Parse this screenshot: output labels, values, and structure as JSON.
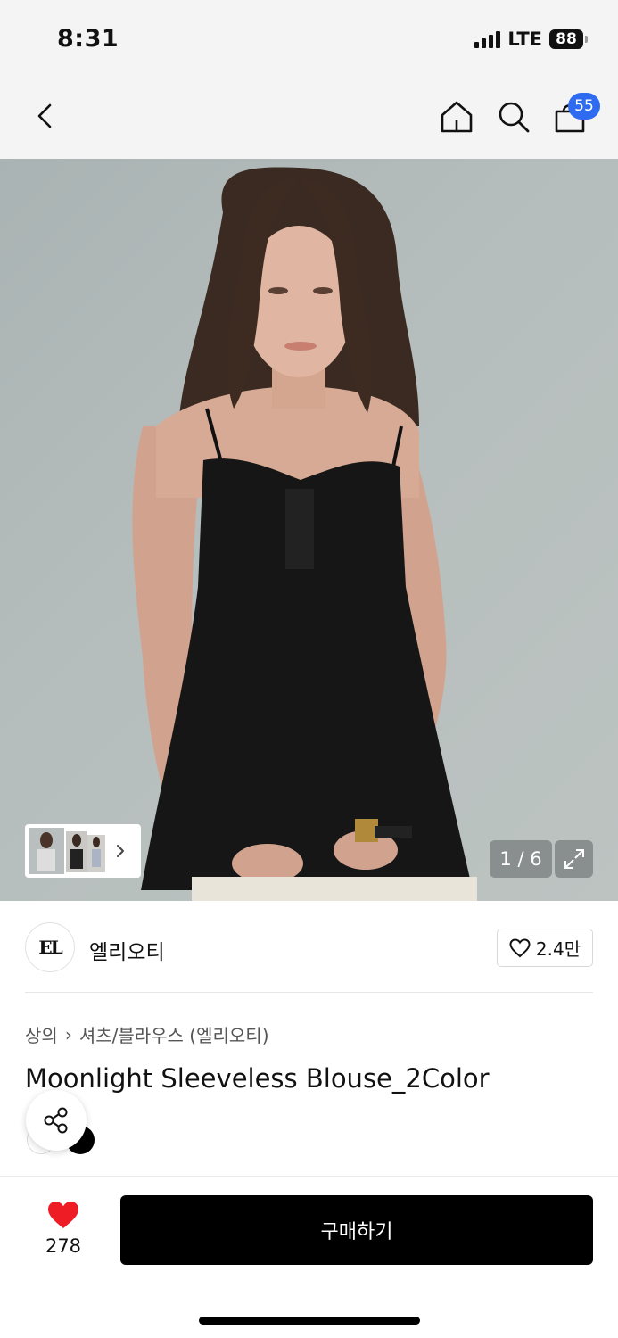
{
  "status_bar": {
    "time": "8:31",
    "network": "LTE",
    "battery": "88"
  },
  "nav": {
    "back_icon": "chevron-left-icon",
    "home_icon": "home-icon",
    "search_icon": "search-icon",
    "cart_icon": "shopping-bag-icon",
    "cart_count": "55",
    "badge_color": "#2f6bf0"
  },
  "gallery": {
    "counter": "1 / 6",
    "expand_icon": "expand-icon",
    "thumbnail_arrow_icon": "chevron-right-icon"
  },
  "brand": {
    "logo_text": "EL",
    "name": "엘리오티",
    "like_count": "2.4만"
  },
  "product": {
    "breadcrumb": [
      "상의",
      "셔츠/블라우스 (엘리오티)"
    ],
    "title": "Moonlight Sleeveless Blouse_2Color",
    "colors": [
      "#ffffff",
      "#000000"
    ]
  },
  "bottom_bar": {
    "like_count": "278",
    "heart_color": "#ee1c25",
    "buy_label": "구매하기"
  }
}
